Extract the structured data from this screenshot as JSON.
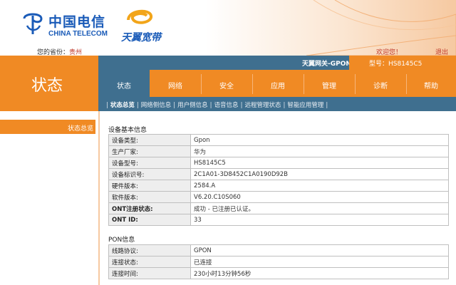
{
  "header": {
    "brand_cn": "中国电信",
    "brand_en": "CHINA TELECOM",
    "product": "天翼宽带",
    "province_label": "您的省份：",
    "province_value": "贵州",
    "welcome": "欢迎您！",
    "logout": "退出"
  },
  "page_title": "状态",
  "gateway": {
    "name": "天翼网关-GPON",
    "model": "型号：HS8145C5"
  },
  "tabs": [
    {
      "label": "状态",
      "active": true
    },
    {
      "label": "网络"
    },
    {
      "label": "安全"
    },
    {
      "label": "应用"
    },
    {
      "label": "管理"
    },
    {
      "label": "诊断"
    },
    {
      "label": "帮助"
    }
  ],
  "subnav": [
    {
      "label": "状态总览",
      "active": true
    },
    {
      "label": "网络侧信息"
    },
    {
      "label": "用户侧信息"
    },
    {
      "label": "语音信息"
    },
    {
      "label": "远程管理状态"
    },
    {
      "label": "智能应用管理"
    }
  ],
  "sidebar": {
    "items": [
      {
        "label": "状态总览",
        "active": true
      }
    ]
  },
  "device_info": {
    "title": "设备基本信息",
    "rows": [
      {
        "key": "设备类型:",
        "value": "Gpon"
      },
      {
        "key": "生产厂家:",
        "value": "华为"
      },
      {
        "key": "设备型号:",
        "value": "HS8145C5"
      },
      {
        "key": "设备标识号:",
        "value": "2C1A01-3D8452C1A0190D92B"
      },
      {
        "key": "硬件版本:",
        "value": "2584.A"
      },
      {
        "key": "软件版本:",
        "value": "V6.20.C10S060"
      },
      {
        "key": "ONT注册状态:",
        "value": "成功 - 已注册已认证。"
      },
      {
        "key": "ONT ID:",
        "value": "33"
      }
    ]
  },
  "pon_info": {
    "title": "PON信息",
    "rows": [
      {
        "key": "线路协议:",
        "value": "GPON"
      },
      {
        "key": "连接状态:",
        "value": "已连接"
      },
      {
        "key": "连接时间:",
        "value": "230小时13分钟56秒"
      }
    ]
  },
  "colors": {
    "orange": "#f08a24",
    "steel_blue": "#3f6f8f",
    "brand_blue": "#1a5bb8",
    "link_red": "#c0392b"
  }
}
